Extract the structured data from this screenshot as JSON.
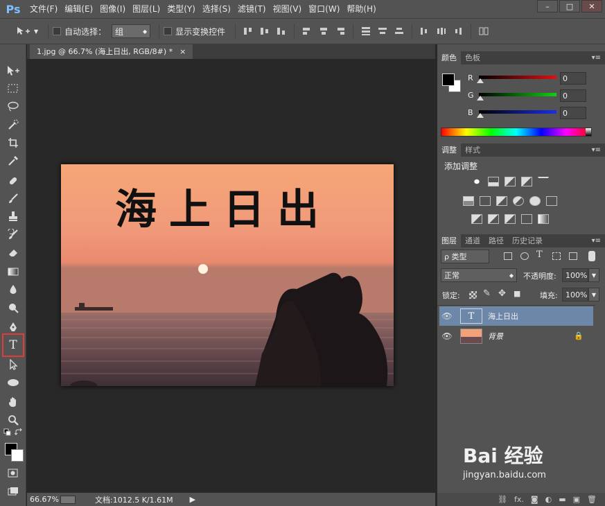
{
  "app": {
    "logo": "Ps"
  },
  "menu": [
    "文件(F)",
    "编辑(E)",
    "图像(I)",
    "图层(L)",
    "类型(Y)",
    "选择(S)",
    "滤镜(T)",
    "视图(V)",
    "窗口(W)",
    "帮助(H)"
  ],
  "window_controls": {
    "minimize": "–",
    "maximize": "□",
    "close": "✕"
  },
  "options": {
    "auto_select_label": "自动选择：",
    "auto_select_value": "组",
    "show_transform_label": "显示变换控件"
  },
  "document": {
    "tab_title": "1.jpg @ 66.7% (海上日出, RGB/8#) *",
    "tab_close": "×",
    "image_text": "海上日出"
  },
  "status": {
    "zoom": "66.67%",
    "doc_info": "文档:1012.5 K/1.61M",
    "arrow": "▶"
  },
  "color_panel": {
    "tabs": [
      "颜色",
      "色板"
    ],
    "r_label": "R",
    "g_label": "G",
    "b_label": "B",
    "r_value": "0",
    "g_value": "0",
    "b_value": "0",
    "r_color": "#d01818",
    "g_color": "#18b818",
    "b_color": "#2030d8"
  },
  "adjust_panel": {
    "tabs": [
      "调整",
      "样式"
    ],
    "title": "添加调整"
  },
  "layers_panel": {
    "tabs": [
      "图层",
      "通道",
      "路径",
      "历史记录"
    ],
    "filter_label": "ρ 类型",
    "blend_mode": "正常",
    "opacity_label": "不透明度:",
    "opacity_value": "100%",
    "lock_label": "锁定:",
    "fill_label": "填充:",
    "fill_value": "100%",
    "layers": [
      {
        "name": "海上日出",
        "thumb": "T",
        "selected": true
      },
      {
        "name": "背景",
        "thumb": "",
        "selected": false
      }
    ],
    "footer_icons": [
      "⛓",
      "fx.",
      "◙",
      "◐",
      "▬",
      "▣",
      "🗑"
    ]
  },
  "watermark": {
    "brand": "Bai 经验",
    "url": "jingyan.baidu.com"
  },
  "colors": {
    "chrome": "#535353",
    "canvas": "#282828",
    "selection": "#6d87a8",
    "highlight": "#e23b3b"
  }
}
